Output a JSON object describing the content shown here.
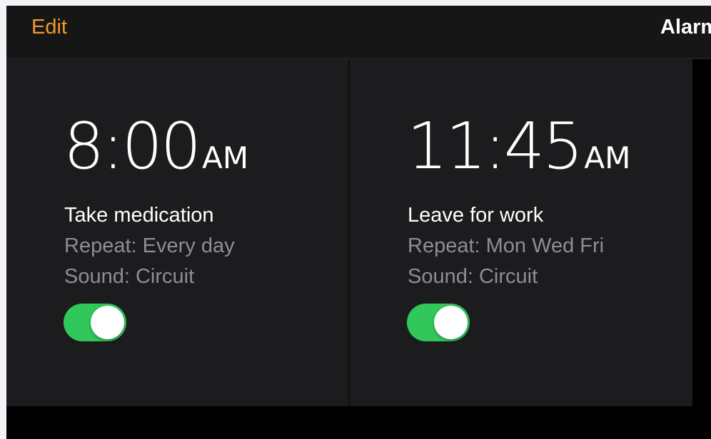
{
  "nav": {
    "edit_label": "Edit",
    "title": "Alarm"
  },
  "alarms": [
    {
      "time": "8:00",
      "ampm": "AM",
      "label": "Take medication",
      "repeat": "Repeat: Every day",
      "sound": "Sound: Circuit",
      "enabled": true
    },
    {
      "time": "11:45",
      "ampm": "AM",
      "label": "Leave for work",
      "repeat": "Repeat: Mon Wed Fri",
      "sound": "Sound: Circuit",
      "enabled": true
    }
  ],
  "colors": {
    "accent": "#f19a2c",
    "toggle_on": "#31c75a",
    "card_background": "#1c1c1e",
    "secondary_text": "#8e8e93"
  }
}
